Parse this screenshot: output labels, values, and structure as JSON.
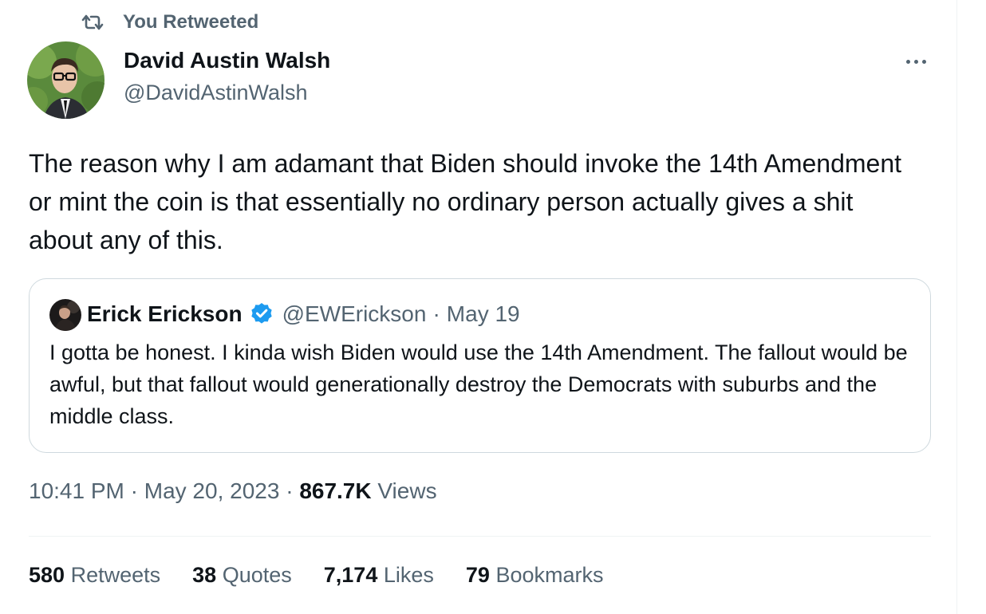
{
  "social_context": {
    "text": "You Retweeted",
    "icon": "retweet-icon"
  },
  "author": {
    "name": "David Austin Walsh",
    "handle": "@DavidAstinWalsh"
  },
  "tweet": {
    "text": "The reason why I am adamant that Biden should invoke the 14th Amendment or mint the coin is that essentially no ordinary person actually gives a shit about any of this."
  },
  "quoted_tweet": {
    "name": "Erick Erickson",
    "handle": "@EWErickson",
    "separator": "·",
    "date": "May 19",
    "verified": true,
    "text": "I gotta be honest.  I kinda wish Biden would use the 14th Amendment.  The fallout would be awful, but that fallout would generationally destroy the Democrats with suburbs and the middle class."
  },
  "meta": {
    "time": "10:41 PM",
    "separator": "·",
    "date": "May 20, 2023",
    "views_count": "867.7K",
    "views_label": "Views"
  },
  "stats": {
    "retweets": {
      "count": "580",
      "label": "Retweets"
    },
    "quotes": {
      "count": "38",
      "label": "Quotes"
    },
    "likes": {
      "count": "7,174",
      "label": "Likes"
    },
    "bookmarks": {
      "count": "79",
      "label": "Bookmarks"
    }
  },
  "colors": {
    "primary_text": "#0f1419",
    "secondary_text": "#536471",
    "border": "#cfd9de",
    "verified": "#1d9bf0"
  }
}
